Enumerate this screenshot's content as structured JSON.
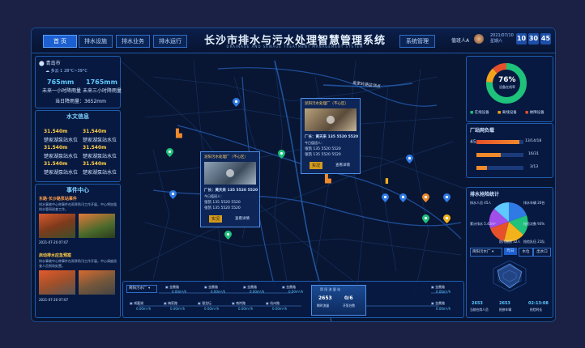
{
  "header": {
    "nav_left": [
      "首 页",
      "排水设施",
      "排水业务",
      "排水运行"
    ],
    "title": "长沙市排水与污水处理智慧管理系统",
    "subtitle": "DRAINAGE AND SEWAGE TREATMENT MANAGEMENT SYSTEM",
    "nav_right": "系统管理",
    "user": "值班人A",
    "date": "2021/07/10",
    "weekday": "星期六",
    "time": [
      "10",
      "30",
      "45"
    ]
  },
  "weather": {
    "city": "青岛市",
    "desc": "多云 1 28°C~39°C",
    "val1": "765mm",
    "val1_label": "未来一小时降雨量",
    "val2": "1765mm",
    "val2_label": "未来三小时降雨量",
    "total": "当日降雨量：3652mm"
  },
  "water_panel": {
    "title": "水文信息",
    "items": [
      {
        "value": "31.540m",
        "label": "楚家湖泵站水位"
      },
      {
        "value": "31.540m",
        "label": "楚家湖泵站水位"
      },
      {
        "value": "31.540m",
        "label": "楚家湖泵站水位"
      },
      {
        "value": "31.540m",
        "label": "楚家湖泵站水位"
      },
      {
        "value": "31.540m",
        "label": "楚家湖泵站水位"
      },
      {
        "value": "31.540m",
        "label": "楚家湖泵站水位"
      }
    ]
  },
  "events": {
    "title": "事件中心",
    "items": [
      {
        "title": "东路·长沙路泵站事件",
        "desc": "排水事故中心称事件在雨季防汛工作开展，中心将加强排水管网巡查工作。",
        "time": "2021-07-20 07:07"
      },
      {
        "title": "启动排水应急预案",
        "desc": "排水事故中心称事件在雨季防汛工作开展，中心调度巡查人员到场处置。",
        "time": "2021-07-20 07:07"
      }
    ]
  },
  "device": {
    "percent": "76%",
    "label": "设备在线率",
    "legend": [
      "在线设备",
      "离线设备",
      "故障设备"
    ],
    "fractions": [
      0.76,
      0.12,
      0.12
    ],
    "colors": [
      "#1ec27b",
      "#f3a21b",
      "#e6502b"
    ]
  },
  "stations": {
    "title": "厂站网负载",
    "rows": [
      {
        "left": "45",
        "value": "13/14/18",
        "fill": 0.92
      },
      {
        "left": "",
        "value": "16/31",
        "fill": 0.52
      },
      {
        "left": "",
        "value": "3/13",
        "fill": 0.23
      }
    ]
  },
  "drainage": {
    "title": "排水抢险统计",
    "labels": [
      "排水人员",
      "排水车辆",
      "累计排水",
      "抢险次数",
      "防汛物资",
      "抢险队伍"
    ],
    "values": [
      "45人",
      "20台",
      "5.42m³",
      "93%",
      "32人",
      "21队"
    ],
    "select": "简阳污水厂",
    "tabs": [
      "昨日",
      "水位",
      "出水口"
    ],
    "bottom": [
      {
        "value": "2653",
        "label": "当前在岗人员"
      },
      {
        "value": "2653",
        "label": "抢修车辆"
      },
      {
        "value": "02:13:08",
        "label": "抢险时长"
      }
    ]
  },
  "popups": [
    {
      "title": "泥阳污水处理厂（不心区）",
      "manager": "厂长：黄天来 135 5520 5520",
      "duty": "今日值班人：",
      "p1": "张凯 135 5520 5520",
      "p2": "张凯 135 5520 5520",
      "btn": "实况",
      "more": "查看详情"
    },
    {
      "title": "泥阳污水处理厂（不心区）",
      "manager": "厂长：黄天来 135 5520 5520",
      "duty": "今日值班人：",
      "p1": "张凯 135 5520 5520",
      "p2": "张凯 135 5520 5520",
      "btn": "实况",
      "more": "查看详情"
    }
  ],
  "map_label": "金家岭路监测点",
  "flow": {
    "select": "简阳污水厂",
    "top": [
      {
        "name": "金鼎路",
        "value": "0.00m³/h"
      },
      {
        "name": "金鼎路",
        "value": "0.00m³/h"
      },
      {
        "name": "金鼎路",
        "value": "0.00m³/h"
      },
      {
        "name": "金鼎路",
        "value": "0.00m³/h"
      }
    ],
    "bottom": [
      {
        "name": "咸嘉湖",
        "value": "0.00m³/h"
      },
      {
        "name": "梅家路",
        "value": "0.00m³/h"
      },
      {
        "name": "银龙坛",
        "value": "0.00m³/h"
      },
      {
        "name": "南岸路",
        "value": "0.00m³/h"
      },
      {
        "name": "机州路",
        "value": "0.00m³/h"
      }
    ],
    "center_title": "简 阳 流 量 站",
    "center_vals": [
      "2653",
      "0/6"
    ],
    "center_labels": [
      "瞬时流量",
      "开泵台数"
    ],
    "right": [
      {
        "name": "金鼎路",
        "value": "0.00m³/h"
      },
      {
        "name": "金鼎路",
        "value": "0.00m³/h"
      }
    ]
  }
}
